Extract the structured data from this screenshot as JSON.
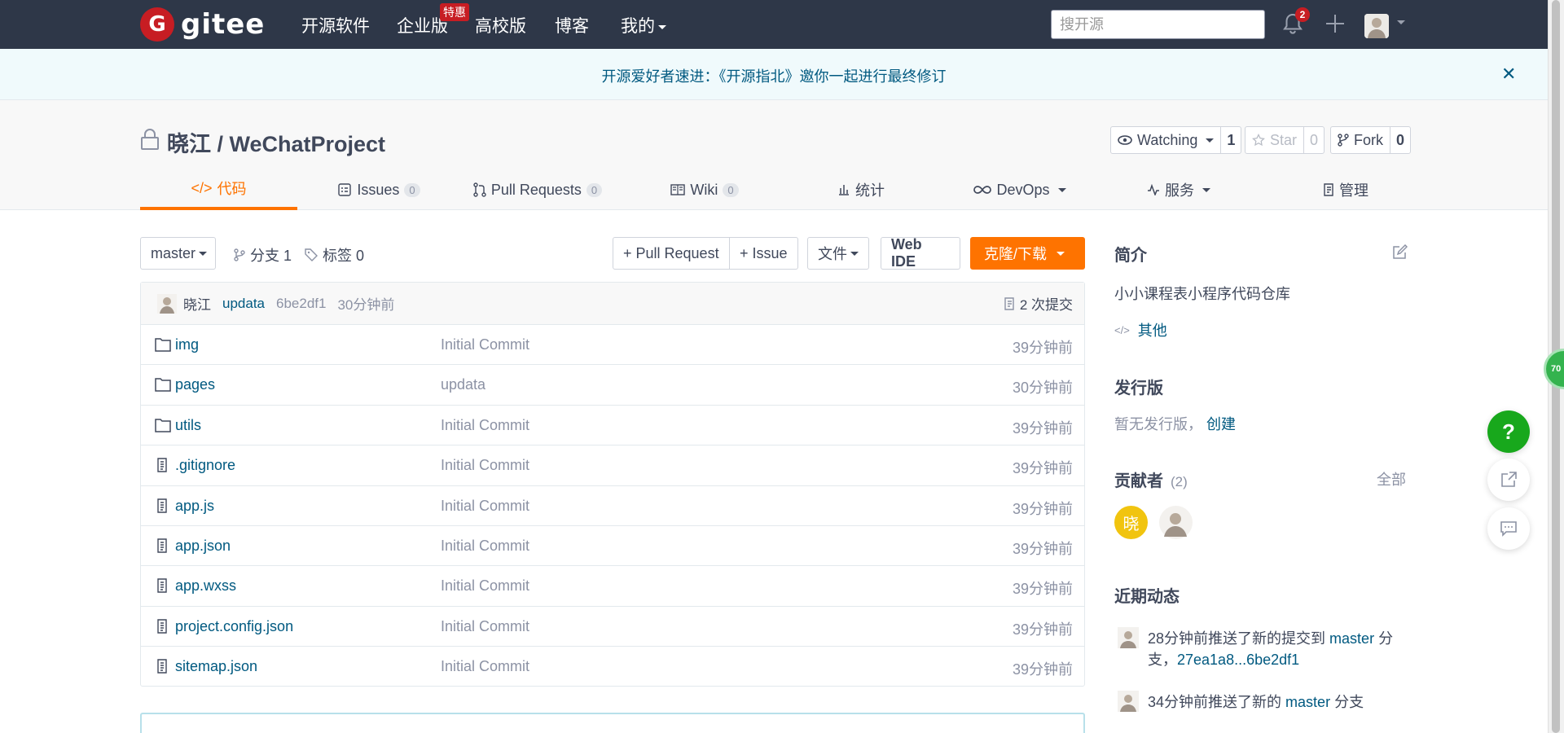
{
  "topnav": {
    "logo_mark": "G",
    "logo_text": "gitee",
    "items": [
      "开源软件",
      "企业版",
      "高校版",
      "博客",
      "我的"
    ],
    "hot_badge": "特惠",
    "search_placeholder": "搜开源",
    "notifications": "2"
  },
  "banner": {
    "text": "开源爱好者速进：《开源指北》邀你一起进行最终修订",
    "close": "✕"
  },
  "repo": {
    "title": "晓江 / WeChatProject",
    "watch_label": "Watching",
    "watch_count": "1",
    "star_label": "Star",
    "star_count": "0",
    "fork_label": "Fork",
    "fork_count": "0"
  },
  "tabs": [
    {
      "label": "代码"
    },
    {
      "label": "Issues",
      "count": "0"
    },
    {
      "label": "Pull Requests",
      "count": "0"
    },
    {
      "label": "Wiki",
      "count": "0"
    },
    {
      "label": "统计"
    },
    {
      "label": "DevOps"
    },
    {
      "label": "服务"
    },
    {
      "label": "管理"
    }
  ],
  "toolbar": {
    "branch": "master",
    "branches": "分支 1",
    "tags": "标签 0",
    "pull_request": "+ Pull Request",
    "issue": "+ Issue",
    "file": "文件",
    "web_ide": "Web IDE",
    "clone": "克隆/下载"
  },
  "commit": {
    "author": "晓江",
    "message": "updata",
    "sha": "6be2df1",
    "time": "30分钟前",
    "count": "2 次提交"
  },
  "files": [
    {
      "name": "img",
      "type": "dir",
      "message": "Initial Commit",
      "time": "39分钟前"
    },
    {
      "name": "pages",
      "type": "dir",
      "message": "updata",
      "time": "30分钟前"
    },
    {
      "name": "utils",
      "type": "dir",
      "message": "Initial Commit",
      "time": "39分钟前"
    },
    {
      "name": ".gitignore",
      "type": "file",
      "message": "Initial Commit",
      "time": "39分钟前"
    },
    {
      "name": "app.js",
      "type": "file",
      "message": "Initial Commit",
      "time": "39分钟前"
    },
    {
      "name": "app.json",
      "type": "file",
      "message": "Initial Commit",
      "time": "39分钟前"
    },
    {
      "name": "app.wxss",
      "type": "file",
      "message": "Initial Commit",
      "time": "39分钟前"
    },
    {
      "name": "project.config.json",
      "type": "file",
      "message": "Initial Commit",
      "time": "39分钟前"
    },
    {
      "name": "sitemap.json",
      "type": "file",
      "message": "Initial Commit",
      "time": "39分钟前"
    }
  ],
  "sidebar": {
    "intro_title": "简介",
    "intro_text": "小小课程表小程序代码仓库",
    "other": "其他",
    "release_title": "发行版",
    "release_text": "暂无发行版，",
    "release_create": "创建",
    "contributors_title": "贡献者",
    "contributors_count": "(2)",
    "contributors_all": "全部",
    "contributor_avatar_char": "晓",
    "activity_title": "近期动态",
    "activity1_prefix": "28分钟前推送了新的提交到",
    "activity1_branch": "master",
    "activity1_mid": "分支，",
    "activity1_range": "27ea1a8...6be2df1",
    "activity2_prefix": "34分钟前推送了新的",
    "activity2_branch": "master",
    "activity2_suffix": "分支"
  },
  "floating": {
    "help": "?",
    "side_ball": "70"
  },
  "colors": {
    "nav_bg": "#2e3748",
    "accent_orange": "#fe7300",
    "link_blue": "#005980",
    "brand_red": "#c71d23",
    "help_green": "#18a81c"
  }
}
